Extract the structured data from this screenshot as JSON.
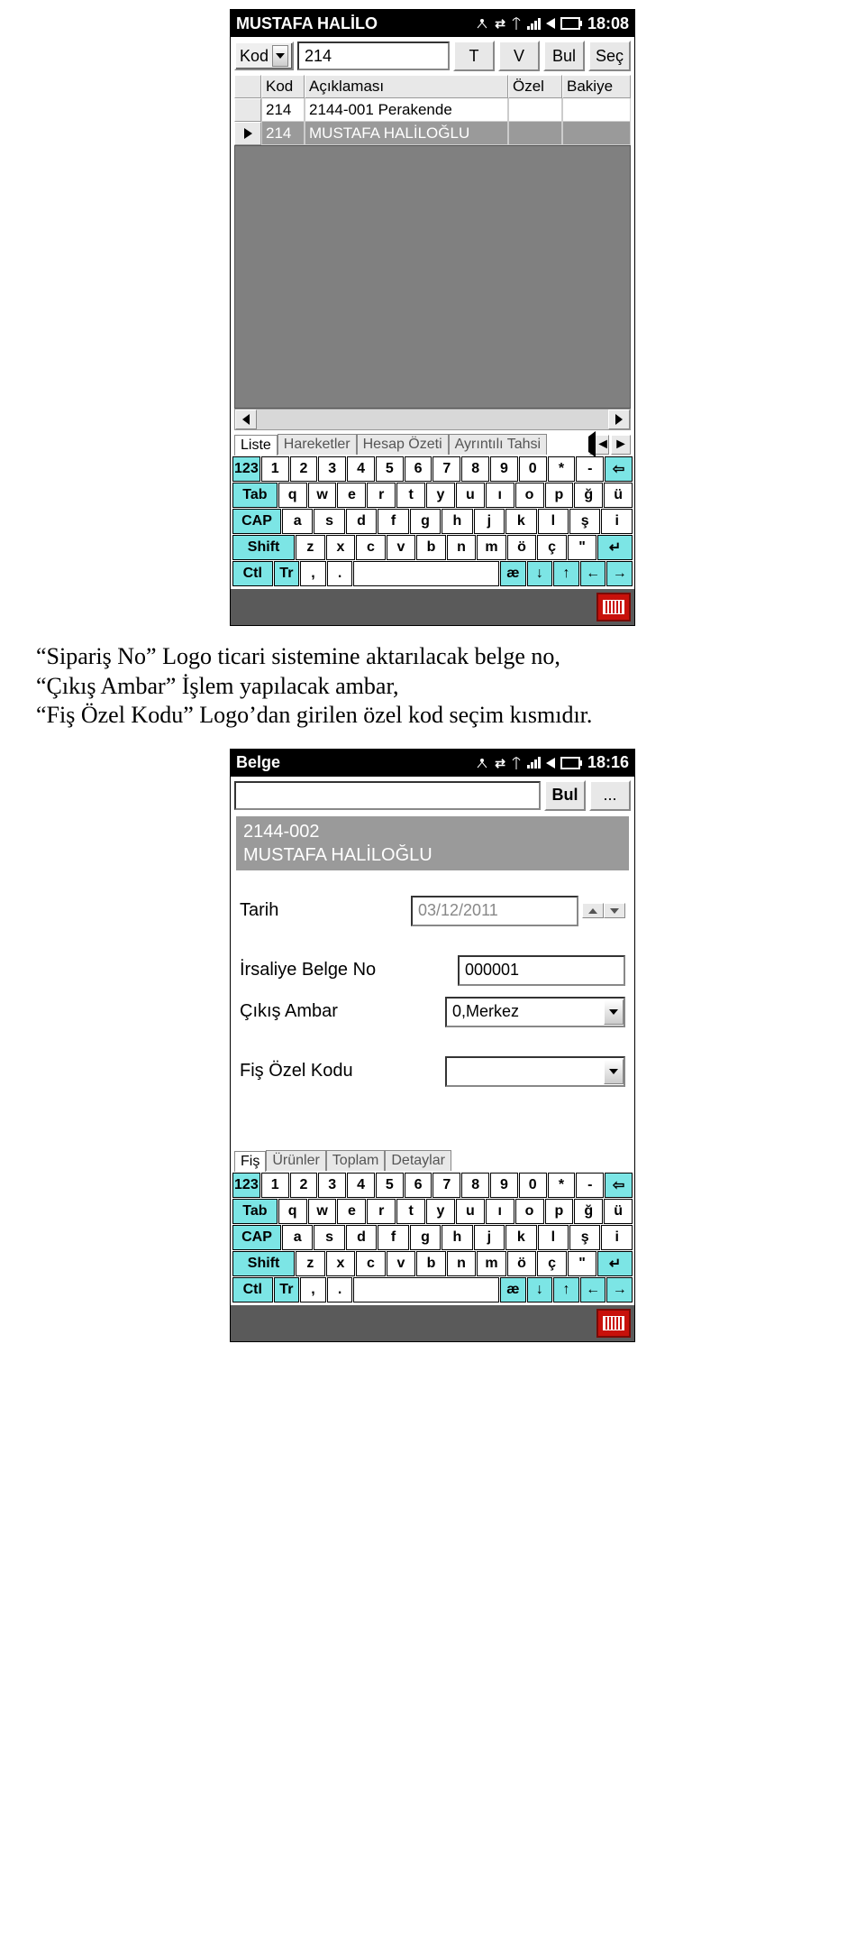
{
  "screen1": {
    "status": {
      "title": "MUSTAFA HALİLO",
      "time": "18:08"
    },
    "toolbar": {
      "combo_label": "Kod",
      "search_value": "214",
      "btn_t": "T",
      "btn_v": "V",
      "btn_bul": "Bul",
      "btn_sec": "Seç"
    },
    "grid": {
      "headers": {
        "kod": "Kod",
        "aciklama": "Açıklaması",
        "ozel": "Özel",
        "bakiye": "Bakiye"
      },
      "rows": [
        {
          "kod": "214",
          "aciklama": "2144-001 Perakende",
          "ozel": "",
          "bakiye": ""
        },
        {
          "kod": "214",
          "aciklama": "MUSTAFA HALİLOĞLU",
          "ozel": "",
          "bakiye": ""
        }
      ]
    },
    "tabs": {
      "t1": "Liste",
      "t2": "Hareketler",
      "t3": "Hesap Özeti",
      "t4": "Ayrıntılı Tahsi"
    },
    "keyboard": {
      "row1": [
        "123",
        "1",
        "2",
        "3",
        "4",
        "5",
        "6",
        "7",
        "8",
        "9",
        "0",
        "*",
        "-",
        "⇦"
      ],
      "row2": [
        "Tab",
        "q",
        "w",
        "e",
        "r",
        "t",
        "y",
        "u",
        "ı",
        "o",
        "p",
        "ğ",
        "ü"
      ],
      "row3": [
        "CAP",
        "a",
        "s",
        "d",
        "f",
        "g",
        "h",
        "j",
        "k",
        "l",
        "ş",
        "i"
      ],
      "row4": [
        "Shift",
        "z",
        "x",
        "c",
        "v",
        "b",
        "n",
        "m",
        "ö",
        "ç",
        "\"",
        "↵"
      ],
      "row5": [
        "Ctl",
        "Tr",
        ",",
        ".",
        " ",
        "æ",
        "↓",
        "↑",
        "←",
        "→"
      ]
    }
  },
  "paragraph": {
    "l1_q1": "“Sipariş No”",
    "l1_rest": " Logo ticari sistemine aktarılacak belge no,",
    "l2_q1": "“Çıkış Ambar”",
    "l2_rest": " İşlem yapılacak ambar,",
    "l3_q1": "“Fiş Özel Kodu”",
    "l3_rest": " Logo’dan girilen özel kod seçim kısmıdır."
  },
  "screen2": {
    "status": {
      "title": "Belge",
      "time": "18:16"
    },
    "toolbar": {
      "search_value": "",
      "btn_bul": "Bul",
      "btn_more": "..."
    },
    "selection": {
      "line1": "2144-002",
      "line2": "MUSTAFA HALİLOĞLU"
    },
    "fields": {
      "tarih_label": "Tarih",
      "tarih_value": "03/12/2011",
      "irsaliye_label": "İrsaliye Belge No",
      "irsaliye_value": "000001",
      "cikis_label": "Çıkış Ambar",
      "cikis_value": "0,Merkez",
      "fisozel_label": "Fiş Özel Kodu",
      "fisozel_value": ""
    },
    "tabs": {
      "t1": "Fiş",
      "t2": "Ürünler",
      "t3": "Toplam",
      "t4": "Detaylar"
    }
  }
}
